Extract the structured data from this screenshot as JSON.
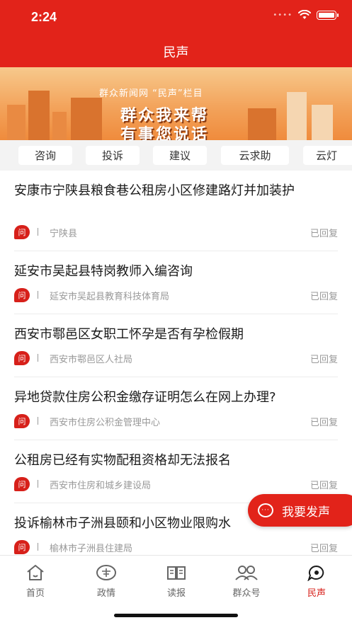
{
  "status_bar": {
    "time": "2:24"
  },
  "header": {
    "title": "民声"
  },
  "banner": {
    "subtitle": "群众新闻网 “民声”栏目",
    "line1": "群众我来帮",
    "line2": "有事您说话"
  },
  "tabs": [
    "咨询",
    "投诉",
    "建议",
    "云求助",
    "云灯"
  ],
  "items": [
    {
      "title": "安康市宁陕县粮食巷公租房小区修建路灯并加装护",
      "badge": "问",
      "dept": "宁陕县",
      "status": "已回复"
    },
    {
      "title": "延安市吴起县特岗教师入编咨询",
      "badge": "问",
      "dept": "延安市吴起县教育科技体育局",
      "status": "已回复"
    },
    {
      "title": "西安市鄠邑区女职工怀孕是否有孕检假期",
      "badge": "问",
      "dept": "西安市鄠邑区人社局",
      "status": "已回复"
    },
    {
      "title": "异地贷款住房公积金缴存证明怎么在网上办理?",
      "badge": "问",
      "dept": "西安市住房公积金管理中心",
      "status": "已回复"
    },
    {
      "title": "公租房已经有实物配租资格却无法报名",
      "badge": "问",
      "dept": "西安市住房和城乡建设局",
      "status": "已回复"
    },
    {
      "title": "投诉榆林市子洲县颐和小区物业限购水",
      "badge": "问",
      "dept": "榆林市子洲县住建局",
      "status": "已回复"
    }
  ],
  "fab": {
    "label": "我要发声"
  },
  "nav": [
    {
      "label": "首页",
      "icon": "home-icon"
    },
    {
      "label": "政情",
      "icon": "government-icon"
    },
    {
      "label": "读报",
      "icon": "newspaper-icon"
    },
    {
      "label": "群众号",
      "icon": "people-icon"
    },
    {
      "label": "民声",
      "icon": "voice-icon",
      "active": true
    }
  ],
  "colors": {
    "primary": "#e2231a",
    "muted": "#999999"
  }
}
